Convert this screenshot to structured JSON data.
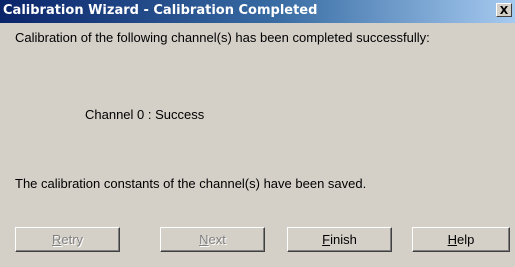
{
  "window": {
    "title": "Calibration Wizard - Calibration Completed",
    "close_glyph": "X"
  },
  "content": {
    "message_intro": "Calibration of the following channel(s) has been completed successfully:",
    "channel_status": "Channel 0 : Success",
    "message_saved": "The calibration constants of the channel(s) have been saved."
  },
  "buttons": {
    "retry": {
      "mnemonic": "R",
      "rest": "etry",
      "enabled": false
    },
    "next": {
      "mnemonic": "N",
      "rest": "ext",
      "enabled": false
    },
    "finish": {
      "mnemonic": "F",
      "rest": "inish",
      "enabled": true
    },
    "help": {
      "mnemonic": "H",
      "rest": "elp",
      "enabled": true
    }
  },
  "colors": {
    "titlebar_start": "#0a246a",
    "titlebar_end": "#a6caf0",
    "dialog_face": "#d4d0c8",
    "disabled_text": "#808080"
  }
}
